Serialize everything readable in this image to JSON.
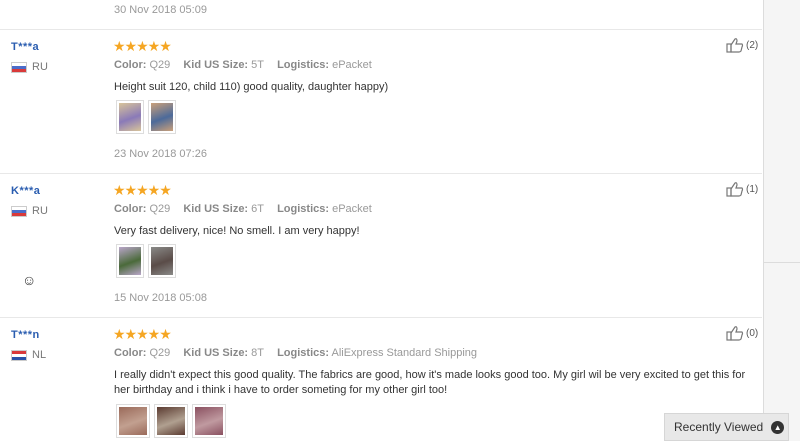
{
  "top_review_date": "30 Nov 2018 05:09",
  "labels": {
    "color": "Color:",
    "size": "Kid US Size:",
    "logistics": "Logistics:"
  },
  "reviews": [
    {
      "user": "T***a",
      "country": "RU",
      "stars": "★★★★★",
      "color": "Q29",
      "size": "5T",
      "logistics": "ePacket",
      "text": "Height suit 120, child 110) good quality, daughter happy)",
      "likes": "(2)",
      "date": "23 Nov 2018 07:26",
      "photos": [
        {
          "name": "review-photo-1",
          "colors": [
            "#d8c49a",
            "#8a7ab8"
          ]
        },
        {
          "name": "review-photo-2",
          "colors": [
            "#caa07a",
            "#4c6a9a"
          ]
        }
      ]
    },
    {
      "user": "K***a",
      "country": "RU",
      "stars": "★★★★★",
      "color": "Q29",
      "size": "6T",
      "logistics": "ePacket",
      "text": "Very fast delivery, nice! No smell. I am very happy!",
      "likes": "(1)",
      "date": "15 Nov 2018 05:08",
      "photos": [
        {
          "name": "review-photo-1",
          "colors": [
            "#b9a6c9",
            "#4a6a3a"
          ]
        },
        {
          "name": "review-photo-2",
          "colors": [
            "#8a8a88",
            "#5a4c48"
          ]
        }
      ]
    },
    {
      "user": "T***n",
      "country": "NL",
      "stars": "★★★★★",
      "color": "Q29",
      "size": "8T",
      "logistics": "AliExpress Standard Shipping",
      "text": "I really didn't expect this good quality. The fabrics are good, how it's made looks good too. My girl wil be very excited to get this for her birthday and i think i have to order someting for my other girl too!",
      "likes": "(0)",
      "date": "",
      "photos": [
        {
          "name": "review-photo-1",
          "colors": [
            "#9a6a5a",
            "#c2a090"
          ]
        },
        {
          "name": "review-photo-2",
          "colors": [
            "#5a3a30",
            "#b0a090"
          ]
        },
        {
          "name": "review-photo-3",
          "colors": [
            "#8a5060",
            "#c09aa0"
          ]
        }
      ]
    }
  ],
  "recently_viewed": {
    "label": "Recently Viewed",
    "icon": "chevron-up-icon"
  },
  "side_panel": {
    "icon": "smiley-icon"
  }
}
